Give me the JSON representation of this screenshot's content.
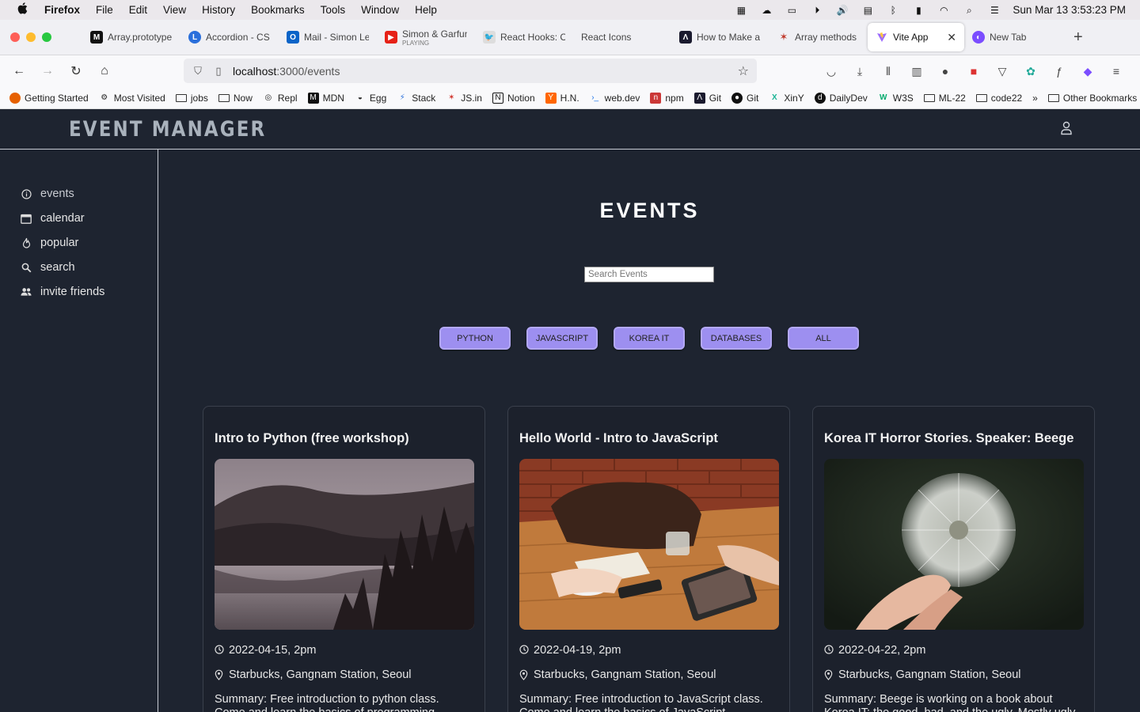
{
  "menubar": {
    "app_name": "Firefox",
    "menus": [
      "File",
      "Edit",
      "View",
      "History",
      "Bookmarks",
      "Tools",
      "Window",
      "Help"
    ],
    "clock": "Sun Mar 13  3:53:23 PM"
  },
  "tabs": [
    {
      "label": "Array.prototype",
      "icon": "mdn-icon",
      "color": "#111111"
    },
    {
      "label": "Accordion - CS",
      "icon": "l-icon",
      "color": "#2a6fdb"
    },
    {
      "label": "Mail - Simon Le",
      "icon": "outlook-icon",
      "color": "#0a64c8"
    },
    {
      "label": "Simon & Garfun",
      "sub": "PLAYING",
      "icon": "youtube-icon",
      "color": "#e62117"
    },
    {
      "label": "React Hooks: C",
      "icon": "bird-icon",
      "color": "#555555"
    },
    {
      "label": "React Icons",
      "icon": "",
      "color": ""
    },
    {
      "label": "How to Make a",
      "icon": "dev-icon",
      "color": "#1a1a2e"
    },
    {
      "label": "Array methods",
      "icon": "figure-icon",
      "color": "#c0392b"
    },
    {
      "label": "Vite App",
      "icon": "vite-icon",
      "color": "#9d6bff",
      "active": true
    },
    {
      "label": "New Tab",
      "icon": "firefox-icon",
      "color": "#7b4dff"
    }
  ],
  "navbar": {
    "url_host": "localhost",
    "url_path": ":3000/events"
  },
  "bookmarks": [
    {
      "label": "Getting Started",
      "icon": "firefox-icon",
      "color": "#e66000"
    },
    {
      "label": "Most Visited",
      "icon": "gear-icon",
      "color": "#333333"
    },
    {
      "label": "jobs",
      "icon": "folder-icon"
    },
    {
      "label": "Now",
      "icon": "folder-icon"
    },
    {
      "label": "Repl",
      "icon": "repl-icon",
      "color": "#333333"
    },
    {
      "label": "MDN",
      "icon": "mdn-icon",
      "color": "#111111"
    },
    {
      "label": "Egg",
      "icon": "egg-icon",
      "color": "#333333"
    },
    {
      "label": "Stack",
      "icon": "lightning-icon",
      "color": "#2a6fdb"
    },
    {
      "label": "JS.in",
      "icon": "js-icon",
      "color": "#d0342c"
    },
    {
      "label": "Notion",
      "icon": "notion-icon",
      "color": "#111111"
    },
    {
      "label": "H.N.",
      "icon": "hn-icon",
      "color": "#ff6600"
    },
    {
      "label": "web.dev",
      "icon": "webdev-icon",
      "color": "#1a73e8"
    },
    {
      "label": "npm",
      "icon": "npm-icon",
      "color": "#cb3837"
    },
    {
      "label": "Git",
      "icon": "git-dev-icon",
      "color": "#1a1a2e"
    },
    {
      "label": "Git",
      "icon": "github-icon",
      "color": "#111111"
    },
    {
      "label": "XinY",
      "icon": "xiny-icon",
      "color": "#1ab394"
    },
    {
      "label": "DailyDev",
      "icon": "dailydev-icon",
      "color": "#111111"
    },
    {
      "label": "W3S",
      "icon": "w3s-icon",
      "color": "#04aa6d"
    },
    {
      "label": "ML-22",
      "icon": "folder-icon"
    },
    {
      "label": "code22",
      "icon": "folder-icon"
    }
  ],
  "other_bookmarks": "Other Bookmarks",
  "overflow_glyph": "»",
  "app": {
    "logo": "EVENT MANAGER",
    "sidebar": [
      {
        "label": "events",
        "icon": "info-icon"
      },
      {
        "label": "calendar",
        "icon": "calendar-icon"
      },
      {
        "label": "popular",
        "icon": "flame-icon"
      },
      {
        "label": "search",
        "icon": "search-icon"
      },
      {
        "label": "invite friends",
        "icon": "people-icon"
      }
    ],
    "page_title": "EVENTS",
    "search_placeholder": "Search Events",
    "filters": [
      "PYTHON",
      "JAVASCRIPT",
      "KOREA IT",
      "DATABASES",
      "ALL"
    ],
    "colors": {
      "accent": "#9d8ff0",
      "background": "#1e2430",
      "logo": "#a9b2bc"
    },
    "events": [
      {
        "title": "Intro to Python (free workshop)",
        "image": "misty forest lake photo",
        "date": "2022-04-15, 2pm",
        "location": "Starbucks, Gangnam Station, Seoul",
        "summary": "Summary: Free introduction to python class. Come and learn the basics of programming"
      },
      {
        "title": "Hello World - Intro to JavaScript",
        "image": "people at wooden cafe table photo",
        "date": "2022-04-19, 2pm",
        "location": "Starbucks, Gangnam Station, Seoul",
        "summary": "Summary: Free introduction to JavaScript class. Come and learn the basics of JavaScript"
      },
      {
        "title": "Korea IT Horror Stories. Speaker: Beege",
        "image": "dandelion seed head in hand photo",
        "date": "2022-04-22, 2pm",
        "location": "Starbucks, Gangnam Station, Seoul",
        "summary": "Summary: Beege is working on a book about Korea IT: the good, bad, and the ugly. Mostly ugly"
      }
    ]
  }
}
